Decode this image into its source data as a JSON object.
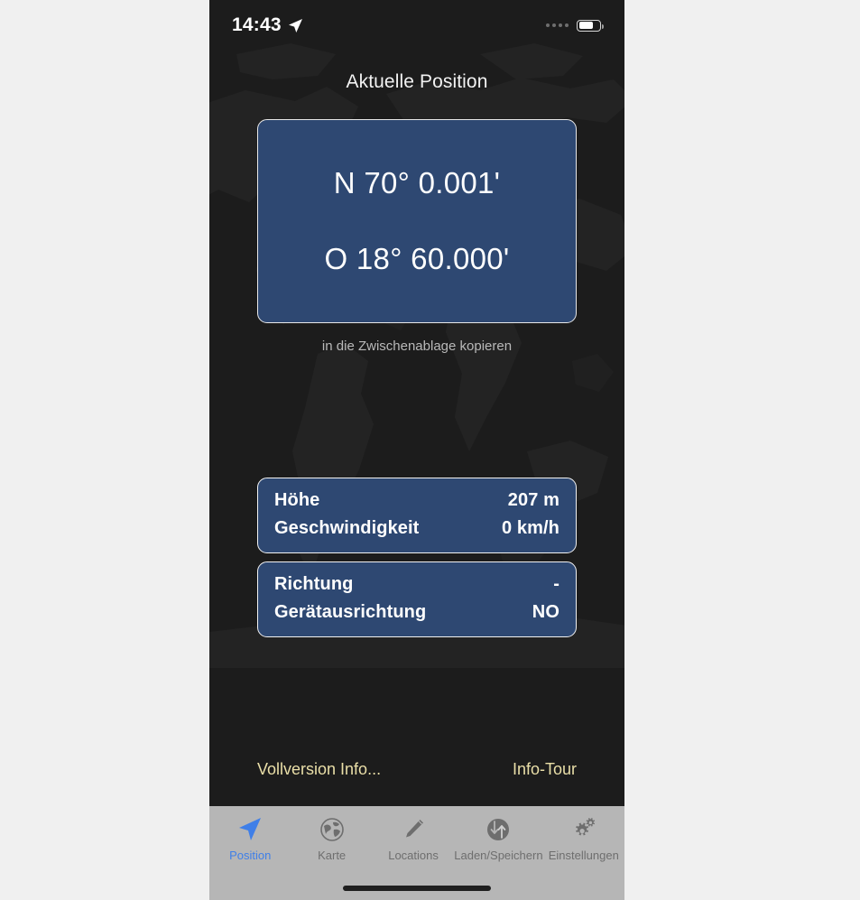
{
  "status_bar": {
    "time": "14:43",
    "location_icon": "location-arrow-icon",
    "signal_icon": "signal-dots-icon",
    "battery_icon": "battery-icon",
    "battery_level_percent": 72
  },
  "header": {
    "title": "Aktuelle Position"
  },
  "coordinates": {
    "latitude": "N 70° 0.001'",
    "longitude": "O 18° 60.000'",
    "copy_hint": "in die Zwischenablage kopieren",
    "card_color": "#2e4872",
    "border_color": "#e8e8e8"
  },
  "info_cards": [
    {
      "rows": [
        {
          "label": "Höhe",
          "value": "207 m"
        },
        {
          "label": "Geschwindigkeit",
          "value": "0 km/h"
        }
      ]
    },
    {
      "rows": [
        {
          "label": "Richtung",
          "value": "-"
        },
        {
          "label": "Gerätausrichtung",
          "value": "NO"
        }
      ]
    }
  ],
  "links": {
    "left": "Vollversion Info...",
    "right": "Info-Tour",
    "color": "#eadfa8"
  },
  "tabbar": {
    "background": "#b6b6b6",
    "active_color": "#3f7fe8",
    "inactive_color": "#6e6e6e",
    "items": [
      {
        "label": "Position",
        "icon": "navigation-arrow-icon",
        "active": true
      },
      {
        "label": "Karte",
        "icon": "globe-icon",
        "active": false
      },
      {
        "label": "Locations",
        "icon": "pencil-icon",
        "active": false
      },
      {
        "label": "Laden/Speichern",
        "icon": "load-save-arrows-icon",
        "active": false
      },
      {
        "label": "Einstellungen",
        "icon": "gears-icon",
        "active": false
      }
    ]
  }
}
